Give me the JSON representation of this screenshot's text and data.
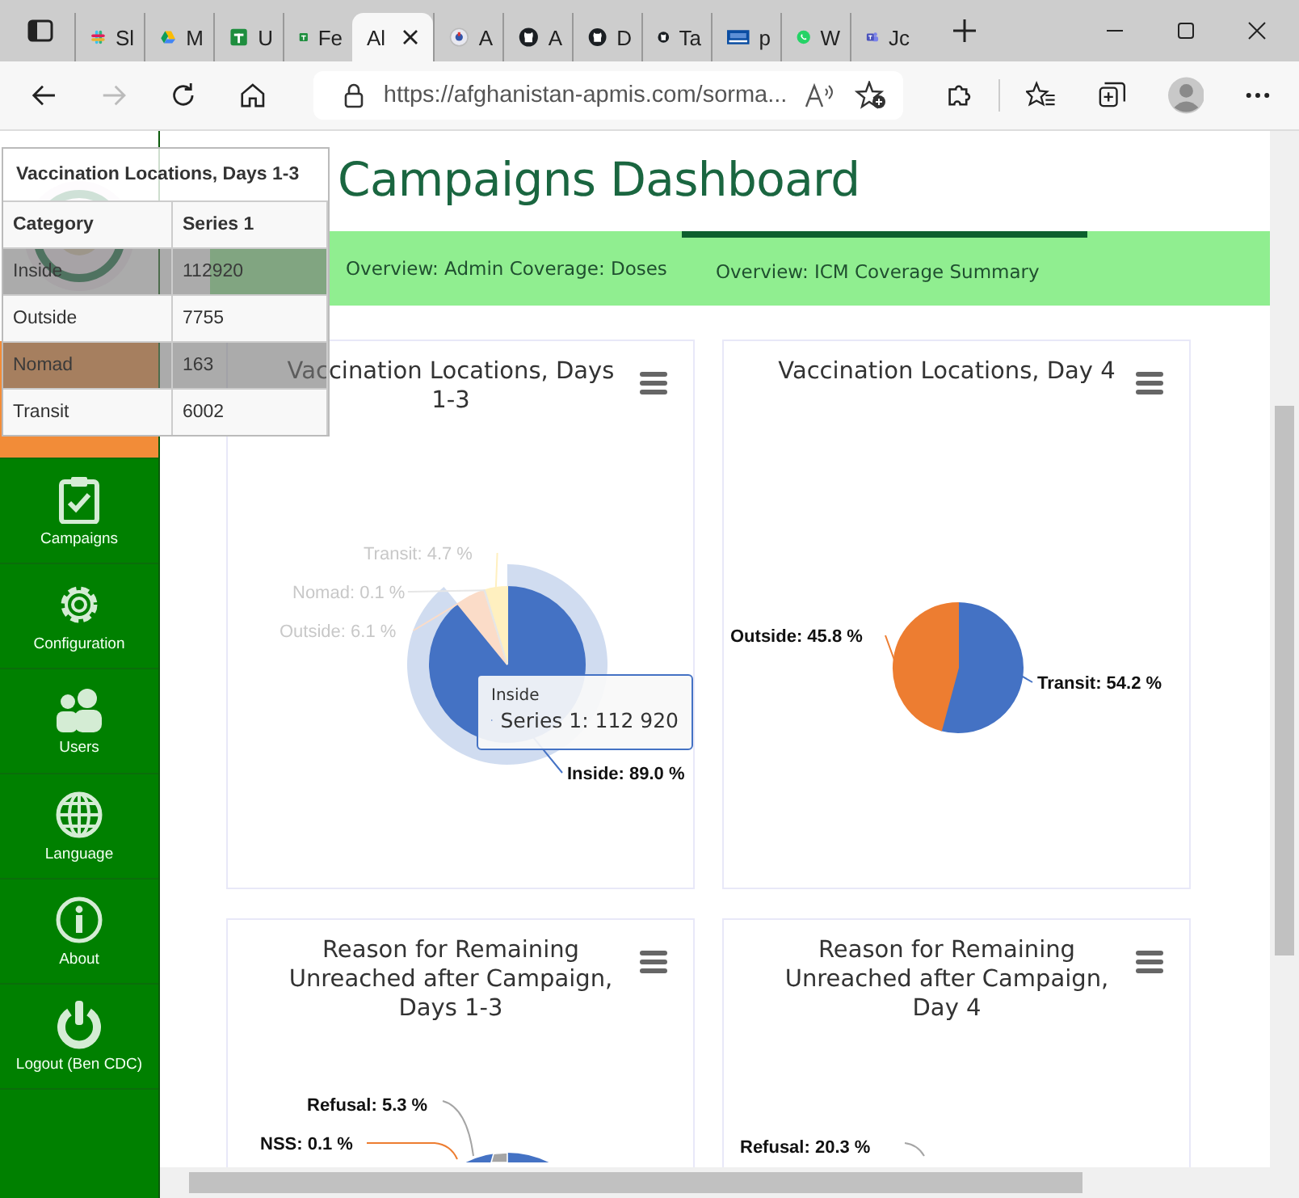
{
  "browser": {
    "tabs": [
      {
        "label": "Sl",
        "selected": false
      },
      {
        "label": "M",
        "selected": false
      },
      {
        "label": "U",
        "selected": false
      },
      {
        "label": "Fe",
        "selected": false
      },
      {
        "label": "Al",
        "selected": true
      },
      {
        "label": "A",
        "selected": false
      },
      {
        "label": "A",
        "selected": false
      },
      {
        "label": "D",
        "selected": false
      },
      {
        "label": "Ta",
        "selected": false
      },
      {
        "label": "p",
        "selected": false
      },
      {
        "label": "W",
        "selected": false
      },
      {
        "label": "Jc",
        "selected": false
      }
    ],
    "address": "https://afghanistan-apmis.com/sorma..."
  },
  "sidebar": {
    "items": [
      {
        "selected": true
      },
      {
        "label": "Campaigns",
        "selected": false
      },
      {
        "label": "Configuration",
        "selected": false
      },
      {
        "label": "Users",
        "selected": false
      },
      {
        "label": "Language",
        "selected": false
      },
      {
        "label": "About",
        "selected": false
      },
      {
        "label": "Logout (Ben CDC)",
        "selected": false
      }
    ]
  },
  "heading": "Campaigns Dashboard",
  "nav": [
    {
      "label": "Overview: Admin Coverage: Doses",
      "selected": false
    },
    {
      "label": "Overview: ICM Coverage Summary",
      "selected": true
    }
  ],
  "data_table": {
    "title": "Vaccination Locations, Days 1-3",
    "columns": [
      "Category",
      "Series 1"
    ],
    "rows": [
      {
        "cells": [
          "Inside",
          "112920"
        ],
        "shaded": true
      },
      {
        "cells": [
          "Outside",
          "7755"
        ],
        "shaded": false
      },
      {
        "cells": [
          "Nomad",
          "163"
        ],
        "shaded": true
      },
      {
        "cells": [
          "Transit",
          "6002"
        ],
        "shaded": false
      }
    ]
  },
  "cards": [
    {
      "title": "Vaccination Locations, Days 1-3",
      "chart_data": {
        "type": "pie",
        "categories": [
          "Inside",
          "Outside",
          "Nomad",
          "Transit"
        ],
        "values": [
          89.0,
          6.1,
          0.1,
          4.7
        ],
        "value_labels": [
          "89.0 %",
          "6.1 %",
          "0.1 %",
          "4.7 %"
        ]
      },
      "slices": [
        {
          "color": "#4472c4",
          "hovered": true
        },
        {
          "color": "#fbdcc8",
          "hovered": false
        },
        {
          "color": "#e6e6e6",
          "hovered": false
        },
        {
          "color": "#fff0c0",
          "hovered": false
        }
      ],
      "tooltip": {
        "title": "Inside",
        "text": "Series 1: 112 920"
      }
    },
    {
      "title": "Vaccination Locations, Day 4",
      "chart_data": {
        "type": "pie",
        "categories": [
          "Transit",
          "Outside"
        ],
        "values": [
          54.2,
          45.8
        ],
        "value_labels": [
          "54.2 %",
          "45.8 %"
        ]
      },
      "slices": [
        {
          "color": "#4472c4",
          "hovered": false
        },
        {
          "color": "#ed7d31",
          "hovered": false
        }
      ]
    },
    {
      "title": "Reason for Remaining Unreached after Campaign, Days 1-3",
      "labels": [
        {
          "text": "Refusal: 5.3 %",
          "color": "#a5a5a5"
        },
        {
          "text": "NSS: 0.1 %",
          "color": "#ed7d31"
        }
      ]
    },
    {
      "title": "Reason for Remaining Unreached after Campaign, Day 4",
      "labels": [
        {
          "text": "Refusal: 20.3 %",
          "color": "#a5a5a5"
        }
      ]
    }
  ]
}
